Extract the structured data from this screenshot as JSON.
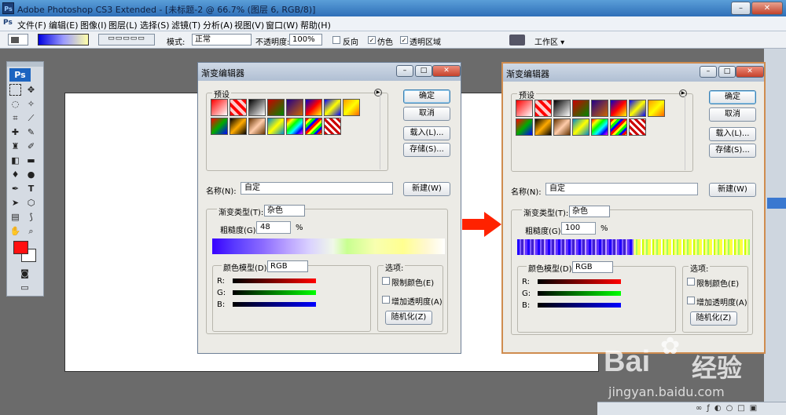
{
  "app": {
    "title": "Adobe Photoshop CS3 Extended - [未标题-2 @ 66.7% (图层 6, RGB/8)]",
    "ps_badge": "Ps"
  },
  "menu": [
    "文件(F)",
    "编辑(E)",
    "图像(I)",
    "图层(L)",
    "选择(S)",
    "滤镜(T)",
    "分析(A)",
    "视图(V)",
    "窗口(W)",
    "帮助(H)"
  ],
  "options": {
    "mode_label": "模式:",
    "mode_value": "正常",
    "opacity_label": "不透明度:",
    "opacity_value": "100%",
    "reverse": "反向",
    "dither": "仿色",
    "transparency": "透明区域",
    "workspace": "工作区 ▾",
    "reverse_checked": false,
    "dither_checked": true,
    "transparency_checked": true
  },
  "toolbox": {
    "logo": "Ps"
  },
  "dialog_a": {
    "title": "渐变编辑器",
    "presets_label": "预设",
    "ok": "确定",
    "cancel": "取消",
    "load": "载入(L)...",
    "save": "存储(S)...",
    "name_label": "名称(N):",
    "name_value": "自定",
    "new_btn": "新建(W)",
    "gtype_label": "渐变类型(T):",
    "gtype_value": "杂色",
    "rough_label": "粗糙度(G):",
    "rough_value": "48",
    "percent": "%",
    "cm_label": "颜色模型(D)",
    "cm_value": "RGB",
    "r": "R:",
    "g": "G:",
    "b": "B:",
    "options_label": "选项:",
    "restrict": "限制颜色(E)",
    "add_transp": "增加透明度(A)",
    "randomize": "随机化(Z)"
  },
  "dialog_b": {
    "title": "渐变编辑器",
    "presets_label": "预设",
    "ok": "确定",
    "cancel": "取消",
    "load": "载入(L)...",
    "save": "存储(S)...",
    "name_label": "名称(N):",
    "name_value": "自定",
    "new_btn": "新建(W)",
    "gtype_label": "渐变类型(T):",
    "gtype_value": "杂色",
    "rough_label": "粗糙度(G):",
    "rough_value": "100",
    "percent": "%",
    "cm_label": "颜色模型(D)",
    "cm_value": "RGB",
    "r": "R:",
    "g": "G:",
    "b": "B:",
    "options_label": "选项:",
    "restrict": "限制颜色(E)",
    "add_transp": "增加透明度(A)",
    "randomize": "随机化(Z)"
  },
  "colors": {
    "arrow": "#ff2200",
    "foreground": "#ff1010",
    "background": "#ffffff"
  },
  "watermark": {
    "brand": "Bai",
    "brand2": "经验",
    "url": "jingyan.baidu.com"
  }
}
